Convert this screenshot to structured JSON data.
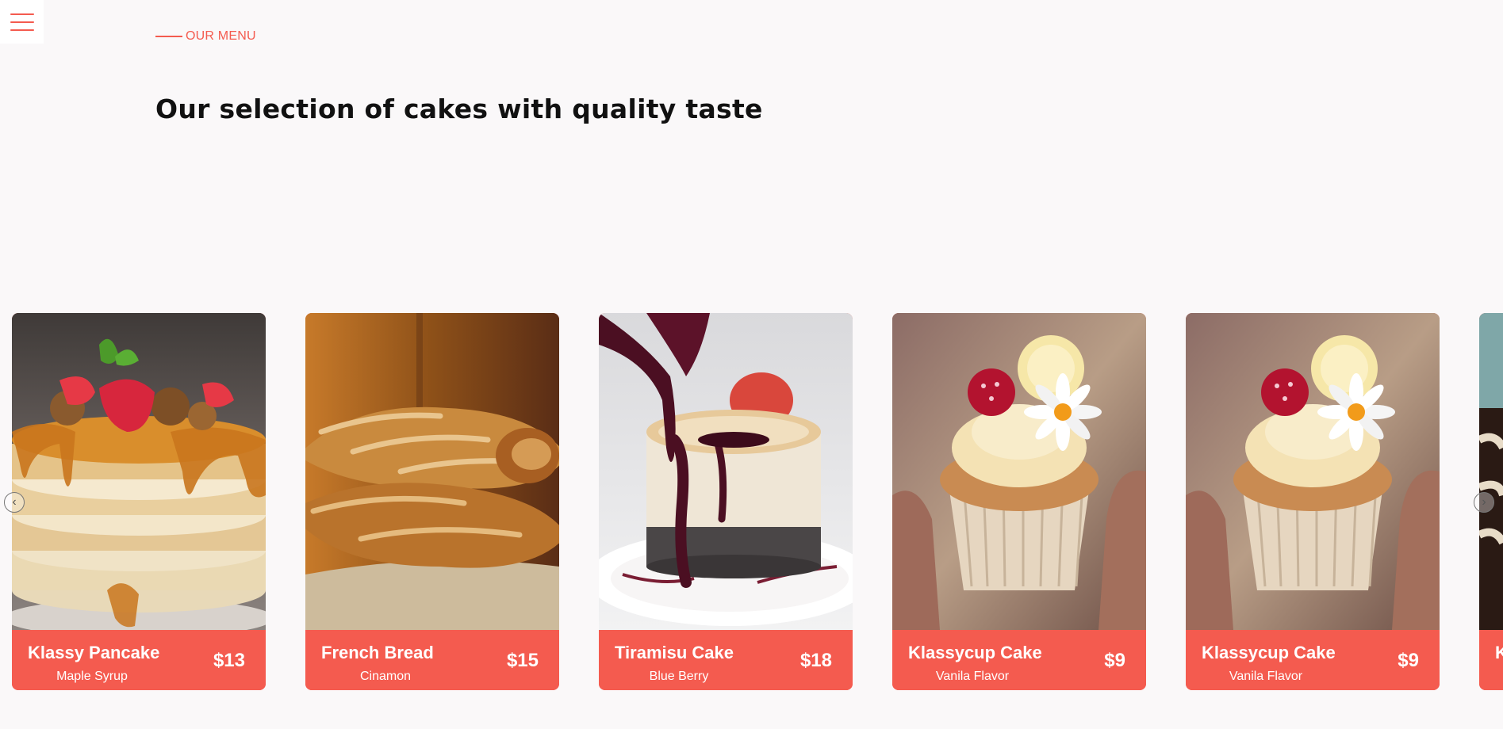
{
  "header": {
    "menu_icon": "hamburger-menu-icon",
    "eyebrow": "OUR MENU",
    "title": "Our selection of cakes with quality taste"
  },
  "colors": {
    "accent": "#f45b4f",
    "background": "#faf8f9",
    "heading": "#111111"
  },
  "carousel": {
    "prev_icon": "chevron-left-icon",
    "next_icon": "chevron-right-icon",
    "items": [
      {
        "name": "Klassy Pancake",
        "flavor": "Maple Syrup",
        "price": "$13",
        "image": "pancake-stack-image"
      },
      {
        "name": "French Bread",
        "flavor": "Cinamon",
        "price": "$15",
        "image": "french-bread-image"
      },
      {
        "name": "Tiramisu Cake",
        "flavor": "Blue Berry",
        "price": "$18",
        "image": "cheesecake-image"
      },
      {
        "name": "Klassycup Cake",
        "flavor": "Vanila Flavor",
        "price": "$9",
        "image": "cupcake-image"
      },
      {
        "name": "Klassycup Cake",
        "flavor": "Vanila Flavor",
        "price": "$9",
        "image": "cupcake-image"
      },
      {
        "name": "K",
        "flavor": "",
        "price": "",
        "image": "chocolate-cake-image"
      }
    ]
  }
}
